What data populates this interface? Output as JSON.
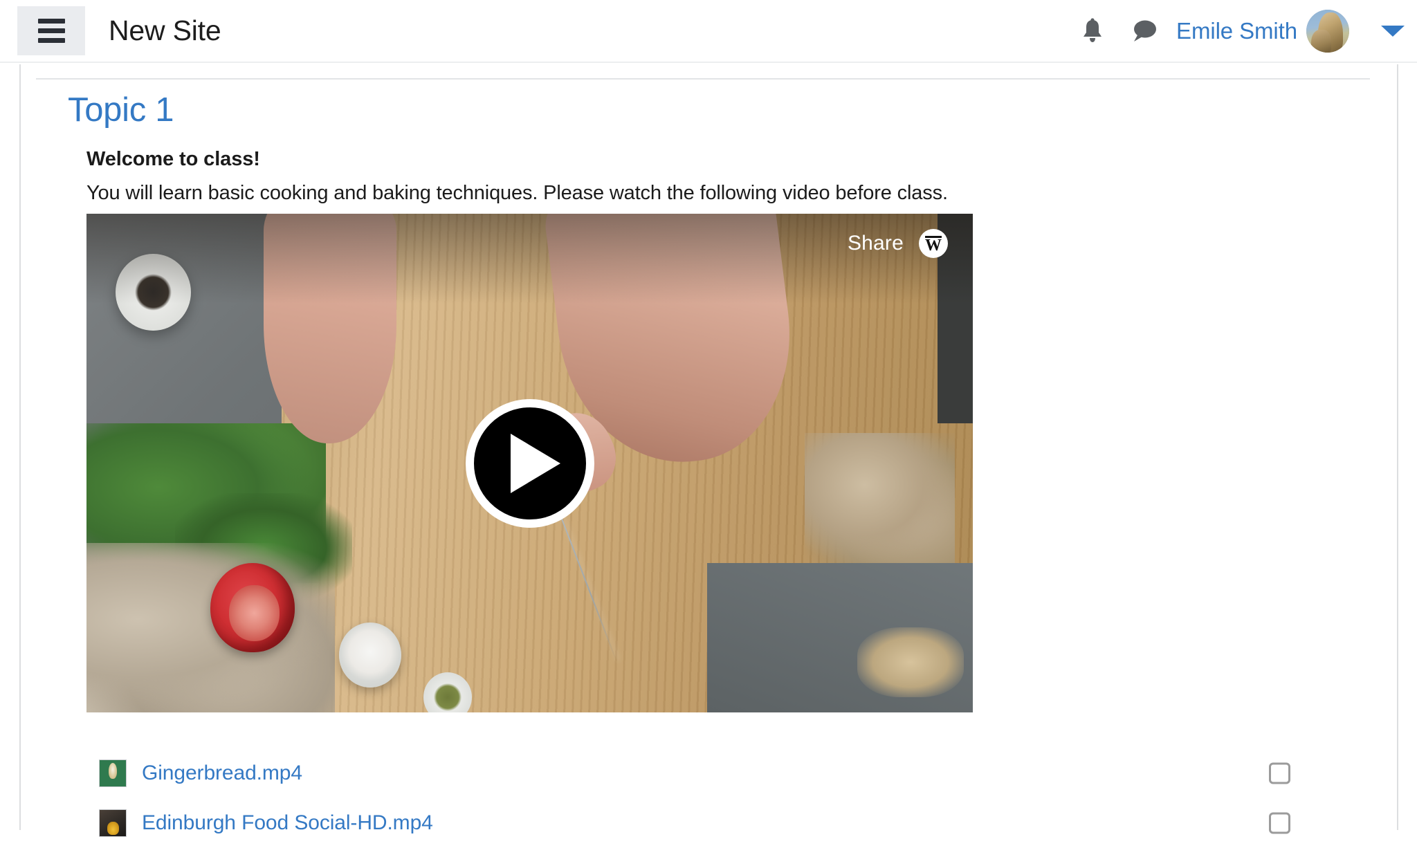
{
  "header": {
    "menu_button_icon": "hamburger-icon",
    "site_title": "New Site",
    "notifications_icon": "bell-icon",
    "messages_icon": "chat-bubble-icon",
    "user_name": "Emile Smith",
    "avatar_alt": "user-avatar",
    "dropdown_icon": "caret-down-icon",
    "link_color": "#3479c4"
  },
  "main": {
    "topic_title": "Topic 1",
    "welcome_heading": "Welcome to class!",
    "intro_text": "You will learn basic cooking and baking techniques. Please watch the following video before class.",
    "video": {
      "share_label": "Share",
      "brand_logo": "wistia-w-logo",
      "play_button_icon": "play-icon",
      "scene_description": "overhead shot of hands slicing mushrooms on a wooden cutting board"
    },
    "files": [
      {
        "name": "Gingerbread.mp4",
        "thumbnail": "video-thumbnail-gingerbread",
        "checkbox_checked": false,
        "checkbox_icon": "checkbox-unchecked-icon"
      },
      {
        "name": "Edinburgh Food Social-HD.mp4",
        "thumbnail": "video-thumbnail-edinburgh",
        "checkbox_checked": false,
        "checkbox_icon": "checkbox-unchecked-icon"
      }
    ]
  }
}
